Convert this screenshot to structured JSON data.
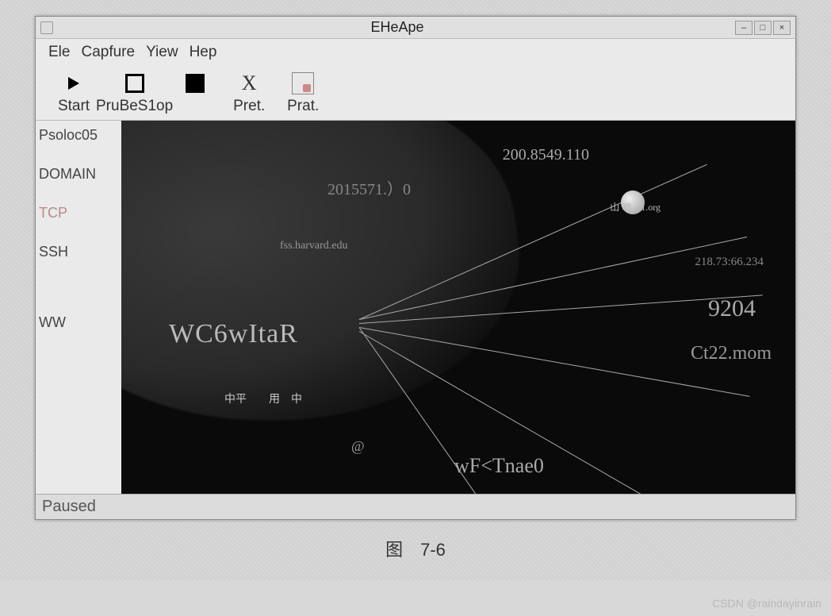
{
  "window": {
    "title": "EHeApe",
    "controls": {
      "min": "–",
      "max": "□",
      "close": "×"
    }
  },
  "menu": {
    "items": [
      "Ele",
      "Capfure",
      "Yiew",
      "Hep"
    ]
  },
  "toolbar": {
    "start_label": "Start",
    "prubes_label": "PruBeS1op",
    "pret_label": "Pret.",
    "prat_label": "Prat."
  },
  "sidebar": {
    "items": [
      "Psoloc05",
      "DOMAIN",
      "TCP",
      "SSH",
      "WW"
    ]
  },
  "canvas": {
    "labels": {
      "ip_top": "200.8549.110",
      "ip_left": "2015571.）0",
      "host1": "fss.harvard.edu",
      "wc6": "WC6wItaR",
      "cjk1": "中平　　用　中",
      "at": "@",
      "wft": "wF<Tnae0",
      "num9204": "9204",
      "ct22": "Ct22.mom",
      "ip_right": "218.73:66.234",
      "cjk2": "山 吻　1.org"
    }
  },
  "status": {
    "text": "Paused"
  },
  "caption": "图　7-6",
  "watermark": "CSDN @raindayinrain"
}
